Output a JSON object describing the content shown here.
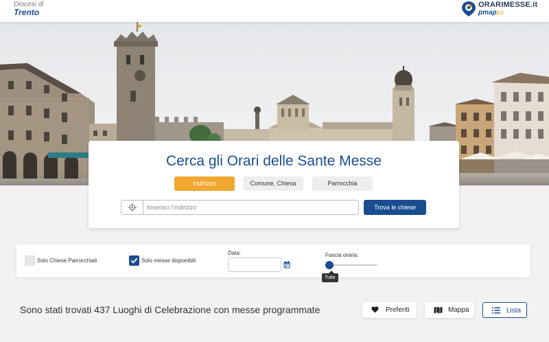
{
  "header": {
    "diocese_prefix": "Diocesi di",
    "diocese_name": "Trento",
    "logo_title": "ORARIMESSE.it",
    "logo_subtitle": "pmap",
    "logo_version": "2.0"
  },
  "search": {
    "title": "Cerca gli Orari delle Sante Messe",
    "tabs": [
      {
        "label": "Indirizzo",
        "active": true
      },
      {
        "label": "Comune, Chiesa",
        "active": false
      },
      {
        "label": "Parrocchia",
        "active": false
      }
    ],
    "address_placeholder": "Inserisci l'indirizzo",
    "address_value": "",
    "find_button": "Trova le chiese",
    "locate_icon": "crosshair-icon"
  },
  "filters": {
    "parish_only_label": "Solo Chiese Parrocchiali",
    "parish_only_checked": false,
    "available_only_label": "Solo messe disponibili",
    "available_only_checked": true,
    "date_label": "Data:",
    "date_value": "",
    "calendar_icon": "calendar-icon",
    "time_range_label": "Fascia oraria:",
    "time_range_tooltip": "Tutte",
    "time_range_position": 0
  },
  "results": {
    "summary": "Sono stati trovati 437 Luoghi di Celebrazione con messe programmate",
    "view_buttons": [
      {
        "label": "Preferiti",
        "icon": "heart-icon"
      },
      {
        "label": "Mappa",
        "icon": "map-icon"
      },
      {
        "label": "Lista",
        "icon": "list-icon",
        "active": true
      }
    ]
  },
  "colors": {
    "brand_blue": "#1a4d8f",
    "accent_orange": "#f0a830",
    "background": "#f2f2f2"
  }
}
